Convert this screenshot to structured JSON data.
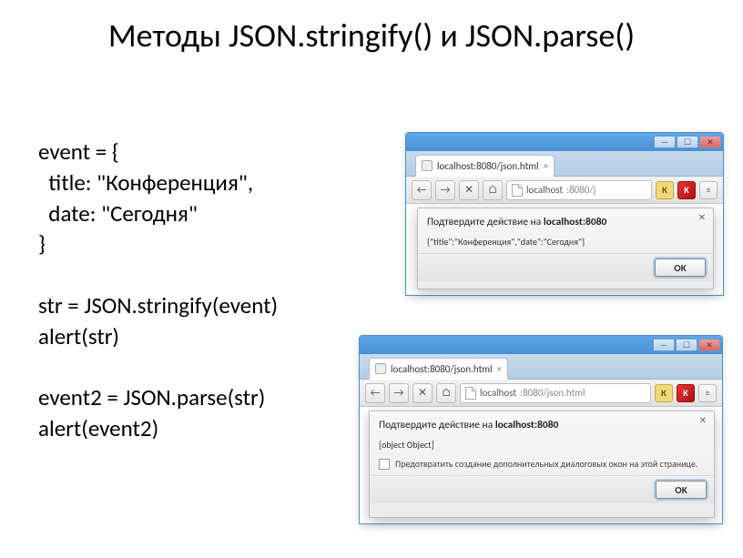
{
  "slide": {
    "title": "Методы JSON.stringify() и JSON.parse()"
  },
  "code": {
    "l1": "event = {",
    "l2": "  title: \"Конференция\",",
    "l3": "  date: \"Сегодня\"",
    "l4": "}",
    "l5": "",
    "l6": "str = JSON.stringify(event)",
    "l7": "alert(str)",
    "l8": "",
    "l9": "event2 = JSON.parse(str)",
    "l10": "alert(event2)"
  },
  "browser1": {
    "tab_label": "localhost:8080/json.html",
    "url_host": "localhost",
    "url_path": ":8080/j",
    "dialog_title_prefix": "Подтвердите действие на ",
    "dialog_host": "localhost:8080",
    "dialog_message": "{\"title\":\"Конференция\",\"date\":\"Сегодня\"}",
    "ok_label": "OK"
  },
  "browser2": {
    "tab_label": "localhost:8080/json.html",
    "url_host": "localhost",
    "url_path": ":8080/json.html",
    "dialog_title_prefix": "Подтвердите действие на ",
    "dialog_host": "localhost:8080",
    "dialog_message": "[object Object]",
    "checkbox_label": "Предотвратить создание дополнительных диалоговых окон на этой странице.",
    "ok_label": "OK"
  },
  "icons": {
    "k_label": "К",
    "av_label": "K"
  }
}
